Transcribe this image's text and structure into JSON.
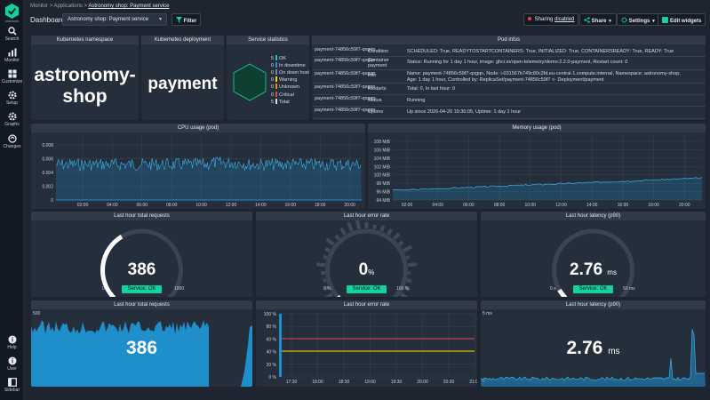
{
  "sidebar": {
    "logo_text": "checkmk",
    "items": [
      {
        "label": "Search",
        "icon": "search-icon"
      },
      {
        "label": "Monitor",
        "icon": "monitor-icon"
      },
      {
        "label": "Customize",
        "icon": "customize-icon"
      },
      {
        "label": "Setup",
        "icon": "setup-icon"
      },
      {
        "label": "Graphs",
        "icon": "graphs-icon"
      },
      {
        "label": "Changes",
        "icon": "changes-icon"
      }
    ],
    "bottom": [
      {
        "label": "Help",
        "icon": "help-icon"
      },
      {
        "label": "User",
        "icon": "user-icon"
      },
      {
        "label": "Sidebar",
        "icon": "sidebar-icon"
      }
    ]
  },
  "breadcrumb": {
    "root": "Monitor",
    "sep": ">",
    "mid": "Applications",
    "current": "Astronomy shop: Payment service"
  },
  "header": {
    "title": "Dashboard",
    "dashboard_select": "Astronomy shop: Payment service",
    "filter_label": "Filter",
    "sharing_prefix": "Sharing",
    "sharing_state": "disabled",
    "share_label": "Share",
    "settings_label": "Settings",
    "edit_label": "Edit widgets"
  },
  "colors": {
    "ok": "#15d1a0",
    "warn": "#ffd000",
    "crit": "#e64545",
    "unknown": "#ff8a00",
    "downtime": "#3a8fd9",
    "chart": "#1f8fcc"
  },
  "k8s_namespace": {
    "title": "Kubernetes namespace",
    "value": "astronomy-shop"
  },
  "k8s_deployment": {
    "title": "Kubernetes deployment",
    "value": "payment"
  },
  "service_stats": {
    "title": "Service statistics",
    "rows": [
      {
        "count": "5",
        "label": "OK",
        "color": "#15d1a0"
      },
      {
        "count": "0",
        "label": "In downtime",
        "color": "#3a8fd9"
      },
      {
        "count": "0",
        "label": "On down host",
        "color": "#7a8494"
      },
      {
        "count": "0",
        "label": "Warning",
        "color": "#ffd000"
      },
      {
        "count": "0",
        "label": "Unknown",
        "color": "#ff8a00"
      },
      {
        "count": "0",
        "label": "Critical",
        "color": "#e64545"
      },
      {
        "count": "5",
        "label": "Total",
        "color": "#d7dce3"
      }
    ]
  },
  "pod_infos": {
    "title": "Pod infos",
    "pod_name": "payment-74856c59f7-qxgqn",
    "rows": [
      {
        "key": "Condition",
        "value": "SCHEDULED: True, READYTOSTARTCONTAINERS: True, INITIALIZED: True, CONTAINERSREADY: True, READY: True"
      },
      {
        "key": "Container payment",
        "value": "Status: Running for 1 day 1 hour, image: ghcr.io/open-telemetry/demo:2.2.0-payment, Restart count: 0"
      },
      {
        "key": "Info",
        "value": "Name: payment-74856c59f7-qxgqn, Node: i-031567b749c80c2fd.eu-central-1.compute.internal, Namespace: astronomy-shop,",
        "value2": "Age: 1 day 1 hour, Controlled by: ReplicaSet/payment-74856c59f7 <- Deployment/payment"
      },
      {
        "key": "Restarts",
        "value": "Total: 0, In last hour: 0"
      },
      {
        "key": "Status",
        "value": "Running"
      },
      {
        "key": "Uptime",
        "value": "Up since 2026-04-20 19:36:05, Uptime: 1 day 1 hour"
      }
    ]
  },
  "cpu": {
    "title": "CPU usage (pod)",
    "yticks": [
      "0.008",
      "0.006",
      "0.004",
      "0.002",
      "0"
    ],
    "xticks": [
      "02:00",
      "04:00",
      "06:00",
      "08:00",
      "10:00",
      "12:00",
      "14:00",
      "16:00",
      "18:00",
      "20:00"
    ]
  },
  "memory": {
    "title": "Memory usage (pod)",
    "yticks": [
      "108 MiB",
      "106 MiB",
      "104 MiB",
      "102 MiB",
      "100 MiB",
      "98 MiB",
      "96 MiB",
      "94 MiB"
    ],
    "xticks": [
      "02:00",
      "04:00",
      "06:00",
      "08:00",
      "10:00",
      "12:00",
      "14:00",
      "16:00",
      "18:00",
      "20:00"
    ]
  },
  "gauge_requests": {
    "title": "Last hour total requests",
    "value": "386",
    "min": "0",
    "max": "1000",
    "status": "Service: OK",
    "fraction": 0.386
  },
  "gauge_error": {
    "title": "Last hour error rate",
    "value": "0",
    "unit": "%",
    "min": "0 %",
    "max": "100 %",
    "status": "Service: OK",
    "fraction": 0
  },
  "gauge_latency": {
    "title": "Last hour latency (p90)",
    "value": "2.76",
    "unit": "ms",
    "min": "0 s",
    "max": "50 ms",
    "status": "Service: OK",
    "fraction": 0.055
  },
  "graph_requests": {
    "title": "Last hour total requests",
    "value": "386",
    "ymax": "500",
    "ymin": "0"
  },
  "graph_error": {
    "title": "Last hour error rate",
    "yticks": [
      "100 %",
      "80 %",
      "60 %",
      "40 %",
      "20 %",
      "0 %"
    ],
    "xticks": [
      "17:30",
      "18:00",
      "18:30",
      "19:00",
      "19:30",
      "20:00",
      "20:30",
      "21:00"
    ]
  },
  "graph_latency": {
    "title": "Last hour latency (p90)",
    "value": "2.76",
    "unit": "ms",
    "ymax": "5 ms",
    "ymin": "0"
  }
}
